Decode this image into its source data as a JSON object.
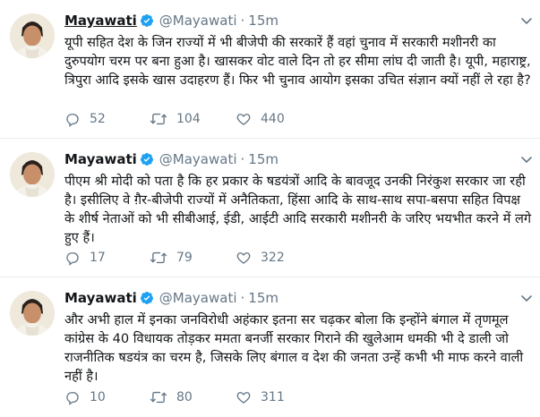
{
  "colors": {
    "verified": "#1da1f2",
    "muted": "#657786",
    "divider": "#e6ecf0"
  },
  "icons": [
    "verified-badge-icon",
    "chevron-down-icon",
    "reply-icon",
    "retweet-icon",
    "like-icon"
  ],
  "tweets": [
    {
      "name": "Mayawati",
      "handle": "@Mayawati",
      "dot": "·",
      "time": "15m",
      "text": "यूपी सहित देश के जिन राज्यों में भी बीजेपी की सरकारें हैं वहां चुनाव में सरकारी मशीनरी का दुरुपयोग चरम पर बना हुआ है। खासकर वोट वाले दिन तो हर सीमा लांघ दी जाती है। यूपी, महाराष्ट्र, त्रिपुरा आदि इसके खास उदाहरण हैं। फिर भी चुनाव आयोग इसका उचित संज्ञान क्यों नहीं ले रहा है?",
      "replies": "52",
      "retweets": "104",
      "likes": "440"
    },
    {
      "name": "Mayawati",
      "handle": "@Mayawati",
      "dot": "·",
      "time": "15m",
      "text": "पीएम श्री मोदी को पता है कि हर प्रकार के षडयंत्रों आदि के बावजूद उनकी निरंकुश सरकार जा रही है। इसीलिए वे ग़ैर-बीजेपी राज्यों में अनैतिकता, हिंसा आदि के साथ-साथ सपा-बसपा सहित विपक्ष के शीर्ष नेताओं को भी सीबीआई, ईडी, आईटी आदि सरकारी मशीनरी के जरिए भयभीत करने में लगे हुए हैं।",
      "replies": "17",
      "retweets": "79",
      "likes": "322"
    },
    {
      "name": "Mayawati",
      "handle": "@Mayawati",
      "dot": "·",
      "time": "15m",
      "text": "और अभी हाल में इनका जनविरोधी अहंकार इतना सर चढ़कर बोला कि इन्होंने बंगाल में तृणमूल कांग्रेस के 40 विधायक तोड़कर ममता बनर्जी सरकार गिराने की खुलेआम धमकी भी दे डाली जो राजनीतिक षडयंत्र का चरम है, जिसके लिए बंगाल व देश की जनता उन्हें कभी भी माफ करने वाली नहीं है।",
      "replies": "10",
      "retweets": "80",
      "likes": "311"
    }
  ]
}
